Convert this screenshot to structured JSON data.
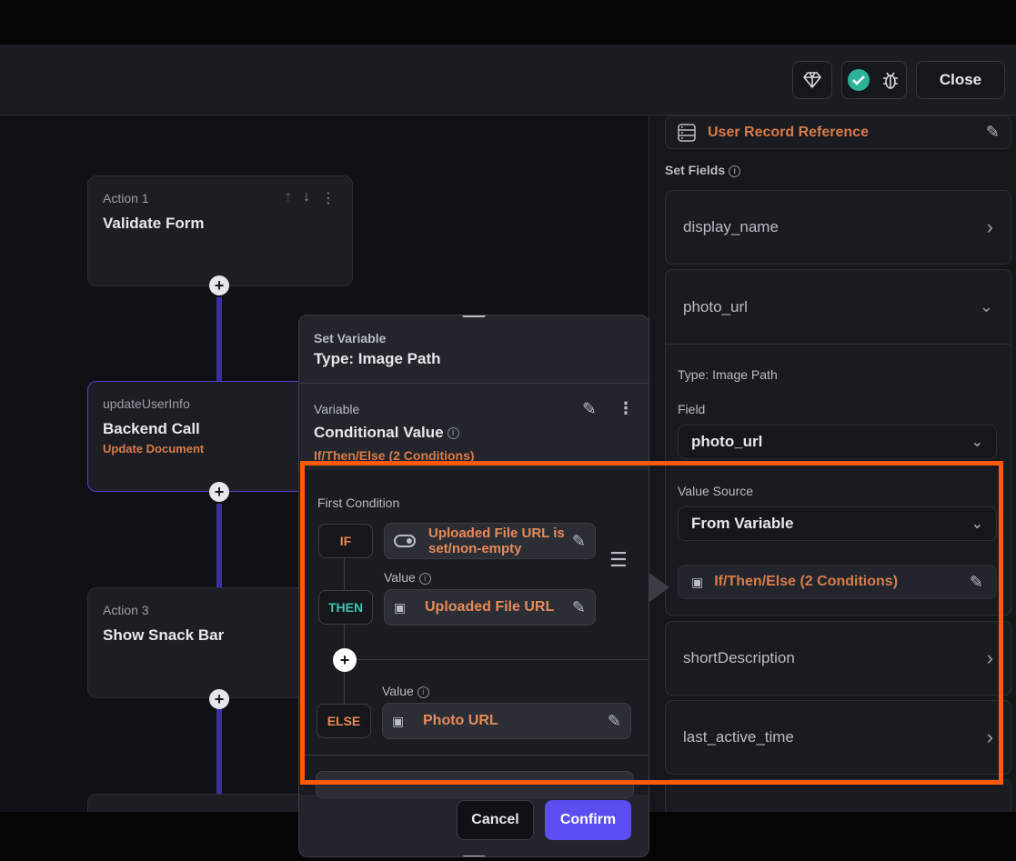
{
  "toolbar": {
    "close_label": "Close"
  },
  "actions": [
    {
      "sub": "Action 1",
      "title": "Validate Form",
      "tag": ""
    },
    {
      "sub": "updateUserInfo",
      "title": "Backend Call",
      "tag": "Update Document"
    },
    {
      "sub": "Action 3",
      "title": "Show Snack Bar",
      "tag": ""
    }
  ],
  "right_panel": {
    "record_ref": "User Record Reference",
    "set_fields_label": "Set Fields",
    "fields": {
      "display_name": "display_name",
      "photo_url": "photo_url",
      "short_description": "shortDescription",
      "last_active_time": "last_active_time"
    },
    "photo_url_detail": {
      "type_label": "Type: Image Path",
      "field_label": "Field",
      "field_value": "photo_url",
      "value_source_label": "Value Source",
      "value_source_value": "From Variable",
      "variable_value": "If/Then/Else (2 Conditions)"
    }
  },
  "dialog": {
    "header_sub": "Set Variable",
    "header_title": "Type: Image Path",
    "variable_label": "Variable",
    "variable_title": "Conditional Value",
    "variable_sub": "If/Then/Else (2 Conditions)",
    "first_condition_label": "First Condition",
    "if_label": "IF",
    "then_label": "THEN",
    "else_label": "ELSE",
    "if_value": "Uploaded File URL is set/non-empty",
    "then_value_label": "Value",
    "then_value": "Uploaded File URL",
    "else_value_label": "Value",
    "else_value": "Photo URL",
    "cancel_label": "Cancel",
    "confirm_label": "Confirm"
  },
  "colors": {
    "accent": "#5b4df0",
    "highlight": "#ff5a0a",
    "orange_text": "#d97b4a",
    "then_color": "#3ec5b0"
  },
  "icons": [
    "gem-icon",
    "check-circle-icon",
    "bug-icon",
    "database-icon",
    "edit-icon",
    "info-icon",
    "chevron-right-icon",
    "chevron-down-icon",
    "toggle-icon",
    "image-icon",
    "more-vert-icon",
    "arrow-up-icon",
    "arrow-down-icon",
    "plus-icon",
    "drag-handle-icon"
  ]
}
